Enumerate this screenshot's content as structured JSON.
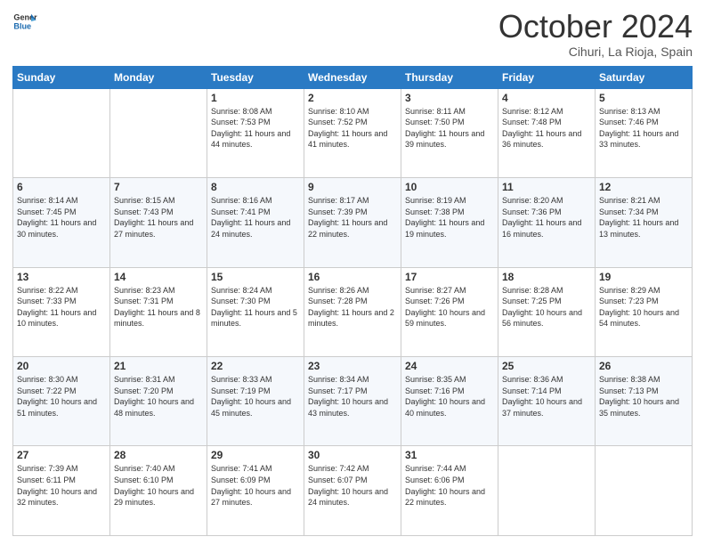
{
  "header": {
    "logo": {
      "line1": "General",
      "line2": "Blue"
    },
    "title": "October 2024",
    "location": "Cihuri, La Rioja, Spain"
  },
  "weekdays": [
    "Sunday",
    "Monday",
    "Tuesday",
    "Wednesday",
    "Thursday",
    "Friday",
    "Saturday"
  ],
  "weeks": [
    [
      {
        "day": "",
        "info": ""
      },
      {
        "day": "",
        "info": ""
      },
      {
        "day": "1",
        "info": "Sunrise: 8:08 AM\nSunset: 7:53 PM\nDaylight: 11 hours and 44 minutes."
      },
      {
        "day": "2",
        "info": "Sunrise: 8:10 AM\nSunset: 7:52 PM\nDaylight: 11 hours and 41 minutes."
      },
      {
        "day": "3",
        "info": "Sunrise: 8:11 AM\nSunset: 7:50 PM\nDaylight: 11 hours and 39 minutes."
      },
      {
        "day": "4",
        "info": "Sunrise: 8:12 AM\nSunset: 7:48 PM\nDaylight: 11 hours and 36 minutes."
      },
      {
        "day": "5",
        "info": "Sunrise: 8:13 AM\nSunset: 7:46 PM\nDaylight: 11 hours and 33 minutes."
      }
    ],
    [
      {
        "day": "6",
        "info": "Sunrise: 8:14 AM\nSunset: 7:45 PM\nDaylight: 11 hours and 30 minutes."
      },
      {
        "day": "7",
        "info": "Sunrise: 8:15 AM\nSunset: 7:43 PM\nDaylight: 11 hours and 27 minutes."
      },
      {
        "day": "8",
        "info": "Sunrise: 8:16 AM\nSunset: 7:41 PM\nDaylight: 11 hours and 24 minutes."
      },
      {
        "day": "9",
        "info": "Sunrise: 8:17 AM\nSunset: 7:39 PM\nDaylight: 11 hours and 22 minutes."
      },
      {
        "day": "10",
        "info": "Sunrise: 8:19 AM\nSunset: 7:38 PM\nDaylight: 11 hours and 19 minutes."
      },
      {
        "day": "11",
        "info": "Sunrise: 8:20 AM\nSunset: 7:36 PM\nDaylight: 11 hours and 16 minutes."
      },
      {
        "day": "12",
        "info": "Sunrise: 8:21 AM\nSunset: 7:34 PM\nDaylight: 11 hours and 13 minutes."
      }
    ],
    [
      {
        "day": "13",
        "info": "Sunrise: 8:22 AM\nSunset: 7:33 PM\nDaylight: 11 hours and 10 minutes."
      },
      {
        "day": "14",
        "info": "Sunrise: 8:23 AM\nSunset: 7:31 PM\nDaylight: 11 hours and 8 minutes."
      },
      {
        "day": "15",
        "info": "Sunrise: 8:24 AM\nSunset: 7:30 PM\nDaylight: 11 hours and 5 minutes."
      },
      {
        "day": "16",
        "info": "Sunrise: 8:26 AM\nSunset: 7:28 PM\nDaylight: 11 hours and 2 minutes."
      },
      {
        "day": "17",
        "info": "Sunrise: 8:27 AM\nSunset: 7:26 PM\nDaylight: 10 hours and 59 minutes."
      },
      {
        "day": "18",
        "info": "Sunrise: 8:28 AM\nSunset: 7:25 PM\nDaylight: 10 hours and 56 minutes."
      },
      {
        "day": "19",
        "info": "Sunrise: 8:29 AM\nSunset: 7:23 PM\nDaylight: 10 hours and 54 minutes."
      }
    ],
    [
      {
        "day": "20",
        "info": "Sunrise: 8:30 AM\nSunset: 7:22 PM\nDaylight: 10 hours and 51 minutes."
      },
      {
        "day": "21",
        "info": "Sunrise: 8:31 AM\nSunset: 7:20 PM\nDaylight: 10 hours and 48 minutes."
      },
      {
        "day": "22",
        "info": "Sunrise: 8:33 AM\nSunset: 7:19 PM\nDaylight: 10 hours and 45 minutes."
      },
      {
        "day": "23",
        "info": "Sunrise: 8:34 AM\nSunset: 7:17 PM\nDaylight: 10 hours and 43 minutes."
      },
      {
        "day": "24",
        "info": "Sunrise: 8:35 AM\nSunset: 7:16 PM\nDaylight: 10 hours and 40 minutes."
      },
      {
        "day": "25",
        "info": "Sunrise: 8:36 AM\nSunset: 7:14 PM\nDaylight: 10 hours and 37 minutes."
      },
      {
        "day": "26",
        "info": "Sunrise: 8:38 AM\nSunset: 7:13 PM\nDaylight: 10 hours and 35 minutes."
      }
    ],
    [
      {
        "day": "27",
        "info": "Sunrise: 7:39 AM\nSunset: 6:11 PM\nDaylight: 10 hours and 32 minutes."
      },
      {
        "day": "28",
        "info": "Sunrise: 7:40 AM\nSunset: 6:10 PM\nDaylight: 10 hours and 29 minutes."
      },
      {
        "day": "29",
        "info": "Sunrise: 7:41 AM\nSunset: 6:09 PM\nDaylight: 10 hours and 27 minutes."
      },
      {
        "day": "30",
        "info": "Sunrise: 7:42 AM\nSunset: 6:07 PM\nDaylight: 10 hours and 24 minutes."
      },
      {
        "day": "31",
        "info": "Sunrise: 7:44 AM\nSunset: 6:06 PM\nDaylight: 10 hours and 22 minutes."
      },
      {
        "day": "",
        "info": ""
      },
      {
        "day": "",
        "info": ""
      }
    ]
  ]
}
